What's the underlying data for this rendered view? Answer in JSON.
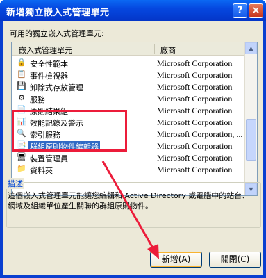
{
  "window": {
    "title": "新增獨立嵌入式管理單元",
    "help_label": "?",
    "close_label": "×"
  },
  "available_label": "可用的獨立嵌入式管理單元:",
  "columns": {
    "name": "嵌入式管理單元",
    "vendor": "廠商"
  },
  "items": [
    {
      "name": "安全性範本",
      "vendor": "Microsoft Corporation",
      "icon": "security-template-icon",
      "glyph": "🔒"
    },
    {
      "name": "事件檢視器",
      "vendor": "Microsoft Corporation",
      "icon": "event-viewer-icon",
      "glyph": "📋"
    },
    {
      "name": "卸除式存放管理",
      "vendor": "Microsoft Corporation",
      "icon": "removable-storage-icon",
      "glyph": "💾"
    },
    {
      "name": "服務",
      "vendor": "Microsoft Corporation",
      "icon": "services-icon",
      "glyph": "⚙"
    },
    {
      "name": "原則結果組",
      "vendor": "Microsoft Corporation",
      "icon": "policy-results-icon",
      "glyph": "📄"
    },
    {
      "name": "效能記錄及警示",
      "vendor": "Microsoft Corporation",
      "icon": "performance-icon",
      "glyph": "📊"
    },
    {
      "name": "索引服務",
      "vendor": "Microsoft Corporation, ...",
      "icon": "indexing-icon",
      "glyph": "🔍"
    },
    {
      "name": "群組原則物件編輯器",
      "vendor": "Microsoft Corporation",
      "icon": "group-policy-icon",
      "glyph": "📑",
      "selected": true
    },
    {
      "name": "裝置管理員",
      "vendor": "Microsoft Corporation",
      "icon": "device-manager-icon",
      "glyph": "🖥"
    },
    {
      "name": "資料夾",
      "vendor": "Microsoft Corporation",
      "icon": "folder-icon",
      "glyph": "📁"
    }
  ],
  "description": {
    "legend": "描述",
    "text": "這個嵌入式管理單元能讓您編輯和 Active Directory 或電腦中的站台、網域及組織單位產生關聯的群組原則物件。"
  },
  "buttons": {
    "add": "新增(A)",
    "close": "關閉(C)"
  },
  "colors": {
    "highlight": "#ec1c3a",
    "selection": "#316ac5",
    "titlebar": "#0548e0"
  }
}
